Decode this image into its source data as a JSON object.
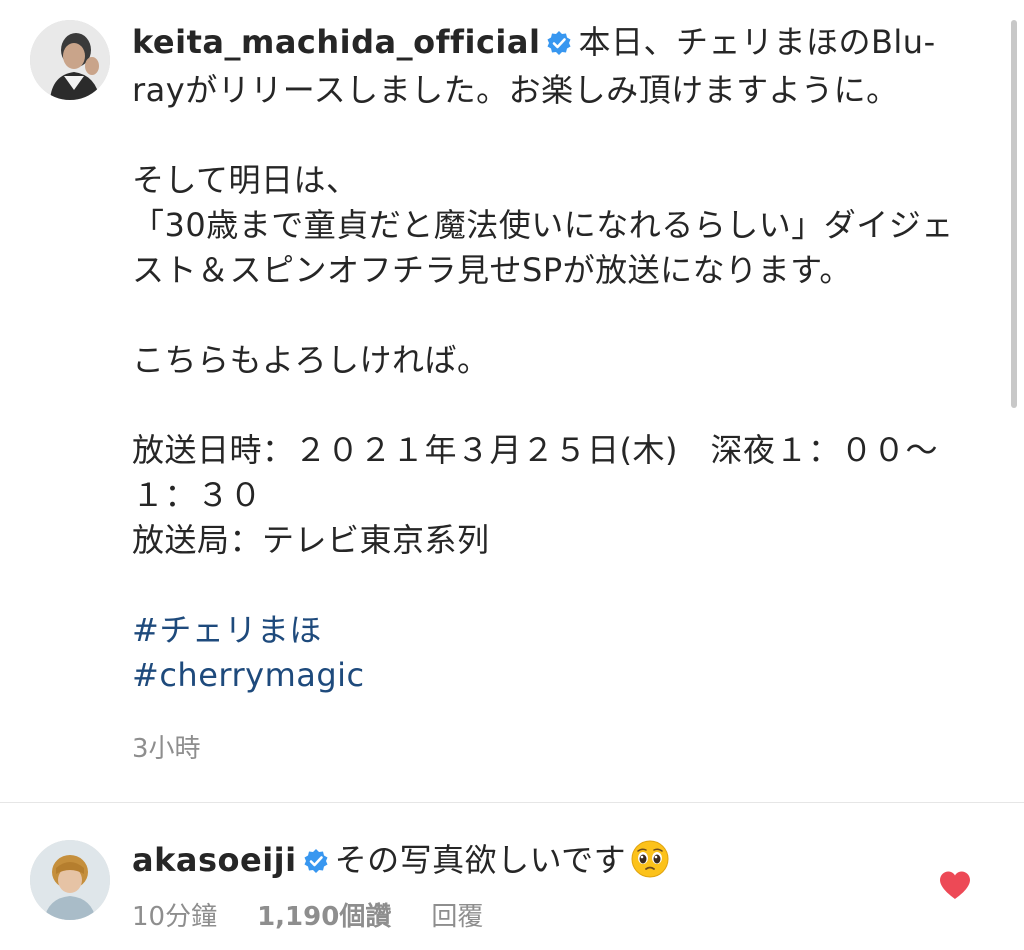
{
  "post": {
    "username": "keita_machida_official",
    "caption_first": "本日、チェリまほのBlu-rayがリリースしました。お楽しみ頂けますように。",
    "para2_line1": "そして明日は、",
    "para2_line2": "「30歳まで童貞だと魔法使いになれるらしい」ダイジェスト＆スピンオフチラ見せSPが放送になります。",
    "para3": "こちらもよろしければ。",
    "broadcast_time": "放送日時：２０２１年３月２５日(木)　深夜１：００～１：３０",
    "broadcast_station": "放送局：テレビ東京系列",
    "hashtags": [
      "#チェリまほ",
      "#cherrymagic"
    ],
    "timestamp": "3小時"
  },
  "reply": {
    "username": "akasoeiji",
    "text": "その写真欲しいです",
    "time": "10分鐘",
    "likes": "1,190個讚",
    "reply_label": "回覆"
  },
  "icons": {
    "verified": "verified-badge-icon",
    "heart": "heart-icon",
    "emoji": "pleading-face-emoji"
  },
  "colors": {
    "verified": "#3897f0",
    "hashtag": "#1e4a7c",
    "heart": "#ed4956",
    "meta": "#8e8e8e",
    "text": "#262626"
  }
}
